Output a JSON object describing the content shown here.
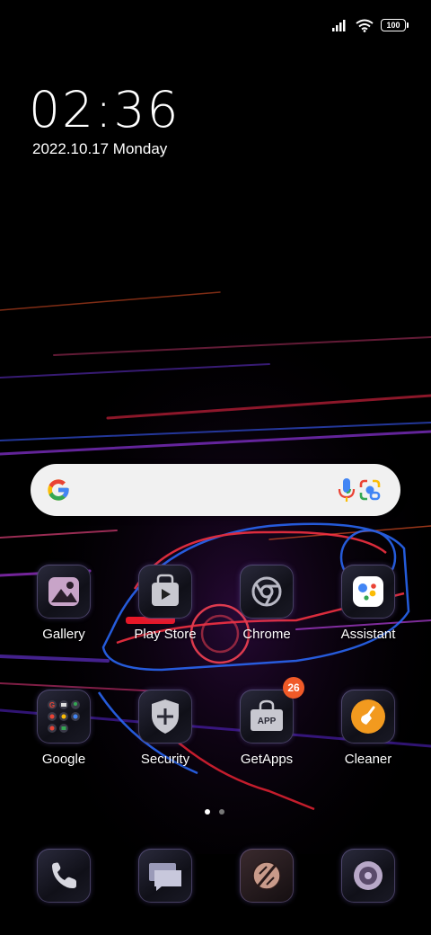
{
  "status_bar": {
    "signal_icon": "signal-icon",
    "wifi_icon": "wifi-icon",
    "battery_level": "100"
  },
  "clock": {
    "time": "02:36",
    "date": "2022.10.17 Monday"
  },
  "search_bar": {
    "logo_icon": "google-g-icon",
    "voice_icon": "mic-icon",
    "lens_icon": "google-lens-icon"
  },
  "apps_row1": [
    {
      "label": "Gallery",
      "icon": "gallery-icon"
    },
    {
      "label": "Play Store",
      "icon": "play-store-icon"
    },
    {
      "label": "Chrome",
      "icon": "chrome-icon"
    },
    {
      "label": "Assistant",
      "icon": "assistant-icon"
    }
  ],
  "apps_row2": [
    {
      "label": "Google",
      "icon": "google-folder-icon"
    },
    {
      "label": "Security",
      "icon": "security-icon"
    },
    {
      "label": "GetApps",
      "icon": "getapps-icon",
      "badge": "26",
      "icon_text": "APP"
    },
    {
      "label": "Cleaner",
      "icon": "cleaner-icon"
    }
  ],
  "page_indicator": {
    "pages": 2,
    "current": 1
  },
  "dock": [
    {
      "icon": "phone-icon"
    },
    {
      "icon": "messages-icon"
    },
    {
      "icon": "camera-icon"
    },
    {
      "icon": "music-icon"
    }
  ],
  "colors": {
    "badge": "#f05a28",
    "search_bg": "#f1f1f1",
    "google_blue": "#4285F4",
    "google_red": "#EA4335",
    "google_yellow": "#FBBC05",
    "google_green": "#34A853",
    "cleaner_orange": "#f29a1f"
  }
}
